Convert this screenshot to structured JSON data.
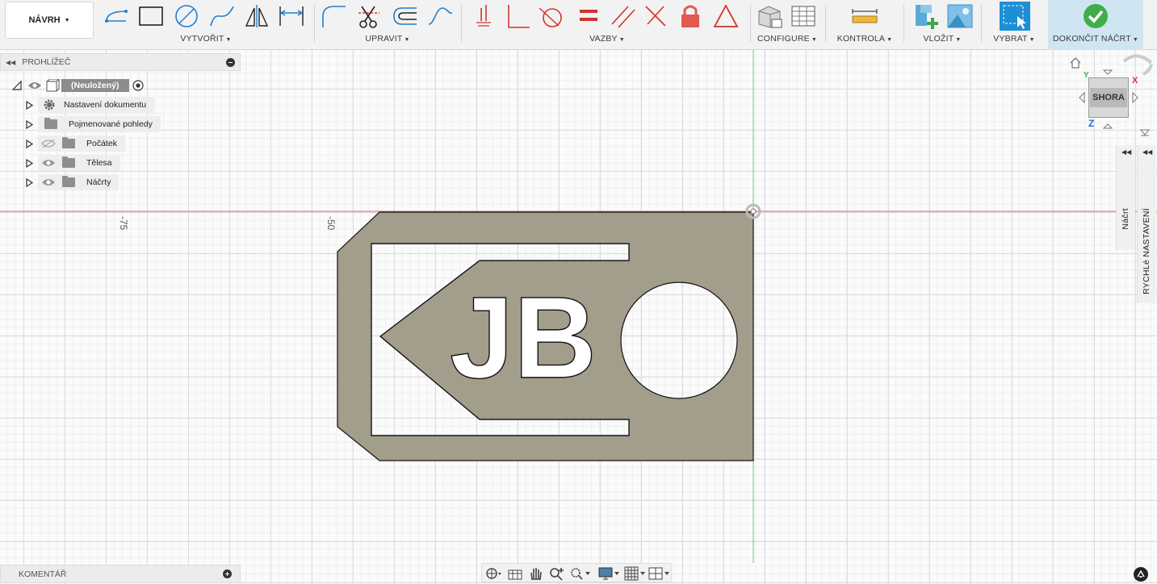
{
  "toolbar": {
    "workspace": "NÁVRH",
    "groups": {
      "create": "VYTVOŘIT",
      "modify": "UPRAVIT",
      "constraints": "VAZBY",
      "configure": "CONFIGURE",
      "inspect": "KONTROLA",
      "insert": "VLOŽIT",
      "select": "VYBRAT",
      "finish": "DOKONČIT NÁČRT"
    }
  },
  "browser": {
    "title": "PROHLÍŽEČ",
    "root": "(Neuložený)",
    "items": [
      {
        "label": "Nastavení dokumentu",
        "icon": "gear-icon"
      },
      {
        "label": "Pojmenované pohledy",
        "icon": "folder-icon"
      },
      {
        "label": "Počátek",
        "icon": "folder-icon"
      },
      {
        "label": "Tělesa",
        "icon": "folder-icon"
      },
      {
        "label": "Náčrty",
        "icon": "folder-icon"
      }
    ]
  },
  "comments": {
    "title": "KOMENTÁŘ"
  },
  "viewcube": {
    "face": "SHORA",
    "axis_y": "Y",
    "axis_x": "X",
    "axis_z": "Z"
  },
  "side_panels": {
    "sketch": "Náčrt",
    "quick_settings": "RYCHLé NASTAVENÍ"
  },
  "rulers": {
    "a": "-75",
    "b": "-50"
  },
  "sketch": {
    "text": "JB",
    "fill_color": "#a39d8c",
    "x_axis_color": "#e06060",
    "y_axis_color": "#6cc36c"
  }
}
